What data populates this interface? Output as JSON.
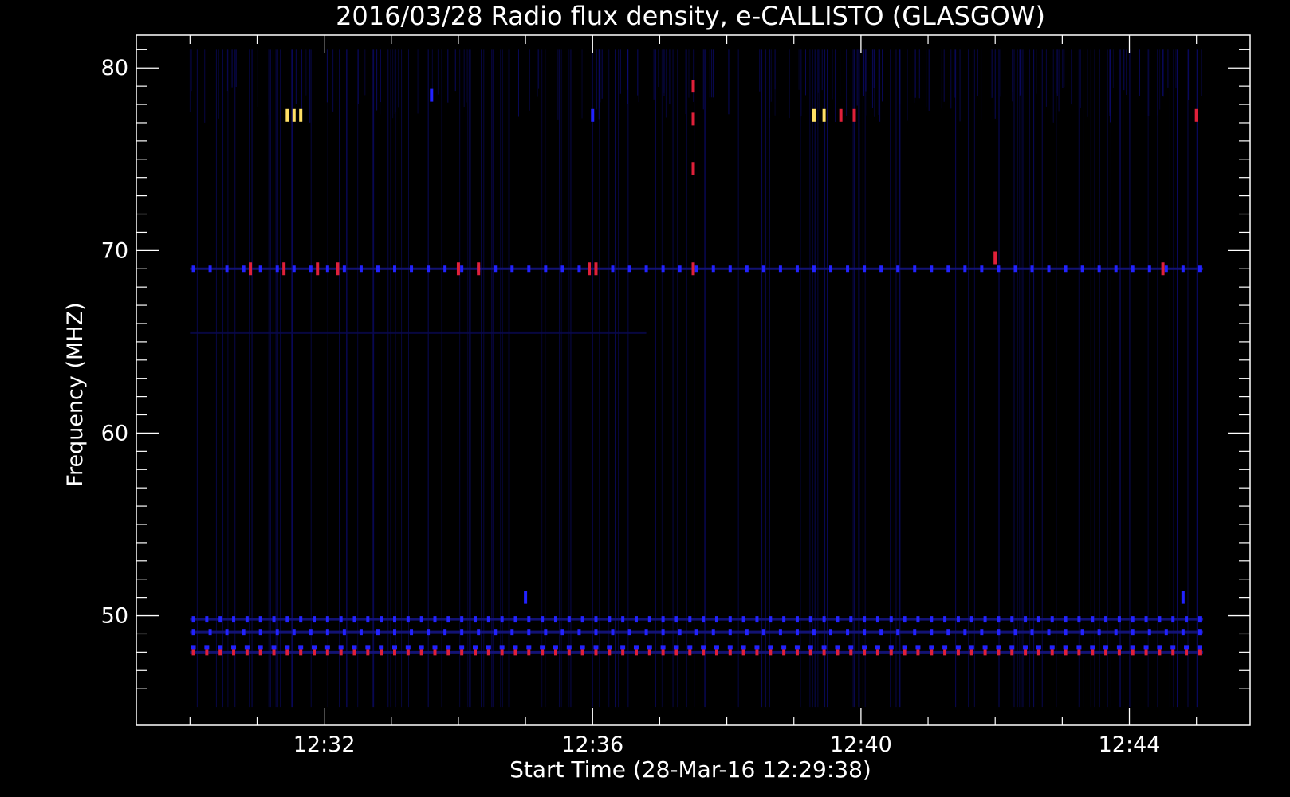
{
  "chart_data": {
    "type": "heatmap",
    "title": "2016/03/28  Radio flux density, e-CALLISTO (GLASGOW)",
    "xlabel": "Start Time (28-Mar-16 12:29:38)",
    "ylabel": "Frequency (MHZ)",
    "x_unit": "minutes since 12:29:38",
    "xlim": [
      -0.8,
      15.8
    ],
    "ylim": [
      81.8,
      44.0
    ],
    "data_xrange": [
      0.0,
      15.1
    ],
    "data_yrange": [
      45.0,
      81.0
    ],
    "x_ticks": [
      {
        "label": "12:32",
        "value": 2.0
      },
      {
        "label": "12:36",
        "value": 6.0
      },
      {
        "label": "12:40",
        "value": 10.0
      },
      {
        "label": "12:44",
        "value": 14.0
      }
    ],
    "y_ticks": [
      {
        "label": "50",
        "value": 50
      },
      {
        "label": "60",
        "value": 60
      },
      {
        "label": "70",
        "value": 70
      },
      {
        "label": "80",
        "value": 80
      }
    ],
    "background_color": "#1c1aa0",
    "colors": {
      "axis": "#ffffff",
      "background": "#000000",
      "low": "#0d0c78",
      "mid": "#2222ff",
      "high": "#e0203a",
      "peak": "#ffe066"
    },
    "interference_bands": [
      {
        "freq": 48.0,
        "intensity": "high"
      },
      {
        "freq": 49.1,
        "intensity": "mid"
      },
      {
        "freq": 49.8,
        "intensity": "mid"
      },
      {
        "freq": 69.0,
        "intensity": "mid"
      }
    ],
    "bursts": [
      {
        "time": 1.45,
        "freq": 77.4,
        "intensity": "peak"
      },
      {
        "time": 1.55,
        "freq": 77.4,
        "intensity": "peak"
      },
      {
        "time": 1.65,
        "freq": 77.4,
        "intensity": "peak"
      },
      {
        "time": 9.3,
        "freq": 77.4,
        "intensity": "peak"
      },
      {
        "time": 9.45,
        "freq": 77.4,
        "intensity": "peak"
      },
      {
        "time": 9.7,
        "freq": 77.4,
        "intensity": "high"
      },
      {
        "time": 9.9,
        "freq": 77.4,
        "intensity": "high"
      },
      {
        "time": 15.0,
        "freq": 77.4,
        "intensity": "high"
      },
      {
        "time": 6.0,
        "freq": 77.4,
        "intensity": "mid"
      },
      {
        "time": 7.5,
        "freq": 77.2,
        "intensity": "high"
      },
      {
        "time": 7.5,
        "freq": 74.5,
        "intensity": "high"
      },
      {
        "time": 7.5,
        "freq": 79.0,
        "intensity": "high"
      },
      {
        "time": 12.0,
        "freq": 69.6,
        "intensity": "high"
      },
      {
        "time": 0.9,
        "freq": 69.0,
        "intensity": "high"
      },
      {
        "time": 1.4,
        "freq": 69.0,
        "intensity": "high"
      },
      {
        "time": 1.9,
        "freq": 69.0,
        "intensity": "high"
      },
      {
        "time": 2.2,
        "freq": 69.0,
        "intensity": "high"
      },
      {
        "time": 4.0,
        "freq": 69.0,
        "intensity": "high"
      },
      {
        "time": 4.3,
        "freq": 69.0,
        "intensity": "high"
      },
      {
        "time": 5.95,
        "freq": 69.0,
        "intensity": "high"
      },
      {
        "time": 6.05,
        "freq": 69.0,
        "intensity": "high"
      },
      {
        "time": 7.5,
        "freq": 69.0,
        "intensity": "high"
      },
      {
        "time": 14.5,
        "freq": 69.0,
        "intensity": "high"
      },
      {
        "time": 5.0,
        "freq": 51.0,
        "intensity": "mid"
      },
      {
        "time": 14.8,
        "freq": 51.0,
        "intensity": "mid"
      },
      {
        "time": 3.6,
        "freq": 78.5,
        "intensity": "mid"
      }
    ]
  }
}
